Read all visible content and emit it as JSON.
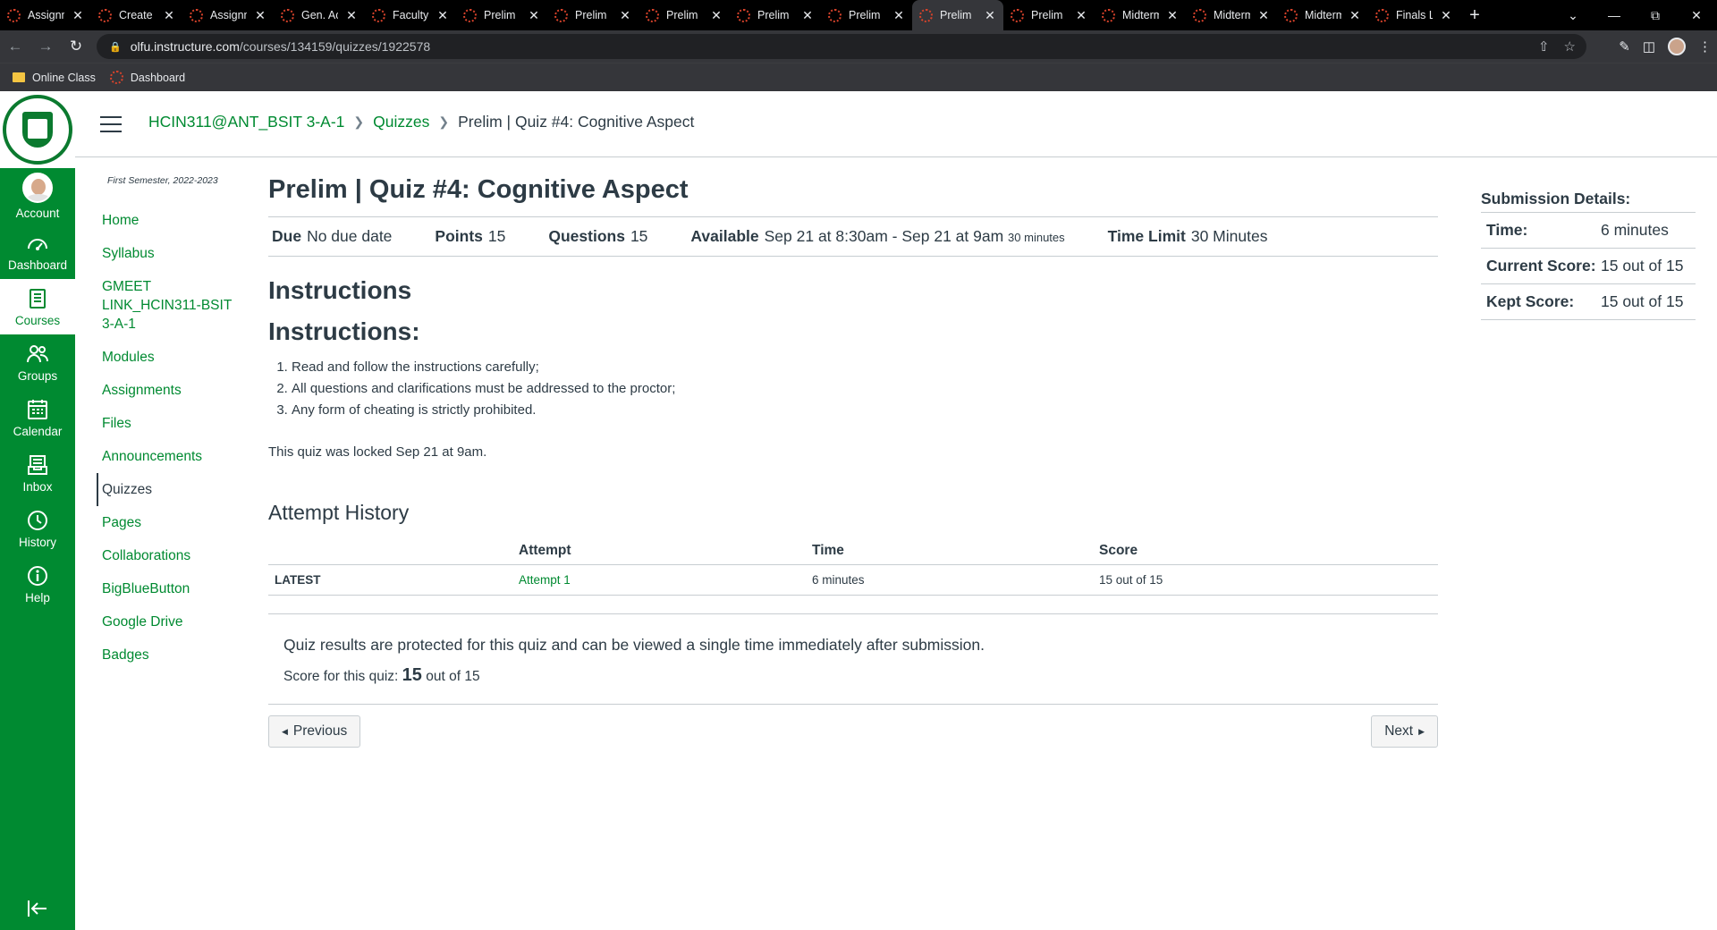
{
  "browser": {
    "tabs": [
      {
        "title": "Assignm"
      },
      {
        "title": "Create"
      },
      {
        "title": "Assignm"
      },
      {
        "title": "Gen. Ac"
      },
      {
        "title": "Faculty"
      },
      {
        "title": "Prelim"
      },
      {
        "title": "Prelim"
      },
      {
        "title": "Prelim"
      },
      {
        "title": "Prelim"
      },
      {
        "title": "Prelim"
      },
      {
        "title": "Prelim",
        "active": true
      },
      {
        "title": "Prelim"
      },
      {
        "title": "Midterm"
      },
      {
        "title": "Midterm"
      },
      {
        "title": "Midterm"
      },
      {
        "title": "Finals L"
      }
    ],
    "url_host": "olfu.instructure.com",
    "url_path": "/courses/134159/quizzes/1922578",
    "bookmarks": [
      {
        "label": "Online Class",
        "icon": "folder-icon"
      },
      {
        "label": "Dashboard",
        "icon": "canvas-icon"
      }
    ]
  },
  "global_nav": {
    "items": [
      {
        "label": "Account",
        "icon": "avatar"
      },
      {
        "label": "Dashboard",
        "icon": "dashboard-icon"
      },
      {
        "label": "Courses",
        "icon": "courses-icon"
      },
      {
        "label": "Groups",
        "icon": "groups-icon"
      },
      {
        "label": "Calendar",
        "icon": "calendar-icon"
      },
      {
        "label": "Inbox",
        "icon": "inbox-icon"
      },
      {
        "label": "History",
        "icon": "history-icon"
      },
      {
        "label": "Help",
        "icon": "help-icon"
      }
    ],
    "accent": "#008a31"
  },
  "breadcrumb": {
    "course": "HCIN311@ANT_BSIT 3-A-1",
    "section": "Quizzes",
    "current": "Prelim | Quiz #4: Cognitive Aspect"
  },
  "course_nav": {
    "term": "First Semester, 2022-2023",
    "items": [
      "Home",
      "Syllabus",
      "GMEET LINK_HCIN311-BSIT 3-A-1",
      "Modules",
      "Assignments",
      "Files",
      "Announcements",
      "Quizzes",
      "Pages",
      "Collaborations",
      "BigBlueButton",
      "Google Drive",
      "Badges"
    ],
    "active": "Quizzes"
  },
  "quiz": {
    "title": "Prelim | Quiz #4: Cognitive Aspect",
    "due_label": "Due",
    "due": "No due date",
    "points_label": "Points",
    "points": "15",
    "questions_label": "Questions",
    "questions": "15",
    "available_label": "Available",
    "available": "Sep 21 at 8:30am - Sep 21 at 9am",
    "available_note": "30 minutes",
    "time_limit_label": "Time Limit",
    "time_limit": "30 Minutes",
    "instructions_heading": "Instructions",
    "instructions_subheading": "Instructions:",
    "rules": [
      "Read and follow the instructions carefully;",
      "All questions and clarifications must be addressed to the proctor;",
      "Any form of cheating is strictly prohibited."
    ],
    "locked_note": "This quiz was locked Sep 21 at 9am."
  },
  "attempt_history": {
    "heading": "Attempt History",
    "columns": [
      "",
      "Attempt",
      "Time",
      "Score"
    ],
    "rows": [
      {
        "tag": "LATEST",
        "attempt": "Attempt 1",
        "time": "6 minutes",
        "score": "15 out of 15"
      }
    ]
  },
  "results": {
    "protected_note": "Quiz results are protected for this quiz and can be viewed a single time immediately after submission.",
    "score_prefix": "Score for this quiz:",
    "score_value": "15",
    "score_suffix": "out of 15"
  },
  "pager": {
    "previous": "Previous",
    "next": "Next"
  },
  "submission": {
    "title": "Submission Details:",
    "rows": [
      {
        "key": "Time:",
        "value": "6 minutes"
      },
      {
        "key": "Current Score:",
        "value": "15 out of 15"
      },
      {
        "key": "Kept Score:",
        "value": "15 out of 15"
      }
    ]
  }
}
